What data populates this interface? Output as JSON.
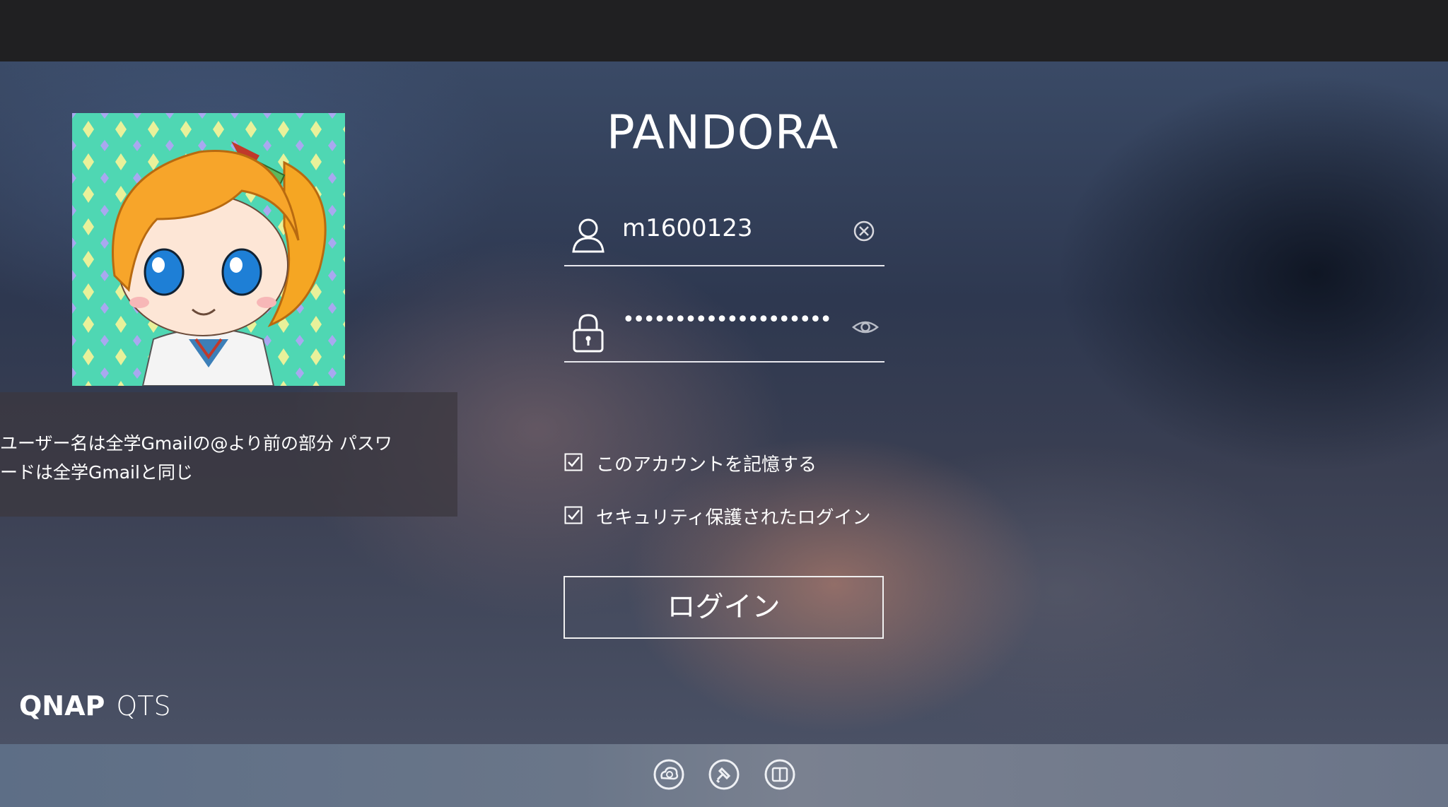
{
  "header": {
    "server_name": "PANDORA"
  },
  "notice": {
    "text": "ユーザー名は全学Gmailの@より前の部分 パスワ\nードは全学Gmailと同じ"
  },
  "login_form": {
    "username": {
      "value": "m1600123",
      "icon": "user-icon",
      "clear_icon": "clear-icon"
    },
    "password": {
      "value": "••••••••••••••••••••",
      "icon": "lock-icon",
      "toggle_icon": "eye-icon"
    },
    "remember_account": {
      "label": "このアカウントを記憶する",
      "checked": true
    },
    "secure_login": {
      "label": "セキュリティ保護されたログイン",
      "checked": true
    },
    "submit_label": "ログイン"
  },
  "brand": {
    "name": "QNAP",
    "product": "QTS"
  },
  "footer": {
    "icons": [
      "qnap-cloud-icon",
      "tools-icon",
      "reader-icon"
    ]
  }
}
